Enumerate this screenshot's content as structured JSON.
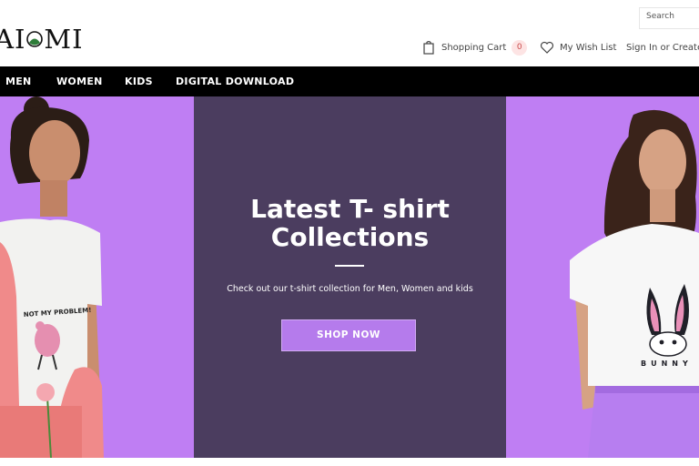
{
  "brand": {
    "logo_text_left": "AI",
    "logo_text_right": "MI"
  },
  "header": {
    "search_placeholder": "Search",
    "cart_label": "Shopping Cart",
    "cart_count": "0",
    "wishlist_label": "My Wish List",
    "signin_label": "Sign In or Create"
  },
  "nav": {
    "items": [
      "MEN",
      "WOMEN",
      "KIDS",
      "DIGITAL DOWNLOAD"
    ]
  },
  "hero": {
    "title_line1": "Latest T- shirt",
    "title_line2": "Collections",
    "subtitle": "Check out our t-shirt collection for Men, Women and kids",
    "button_label": "SHOP NOW",
    "left_shirt_text": "NOT MY PROBLEM!",
    "right_shirt_text": "BUNNY"
  },
  "colors": {
    "hero_purple": "#bf7ef3",
    "hero_dark": "#4b3d5f",
    "button_purple": "#b57bec",
    "navbar": "#000000"
  },
  "icons": [
    "cart-icon",
    "heart-icon",
    "leaf-icon"
  ]
}
